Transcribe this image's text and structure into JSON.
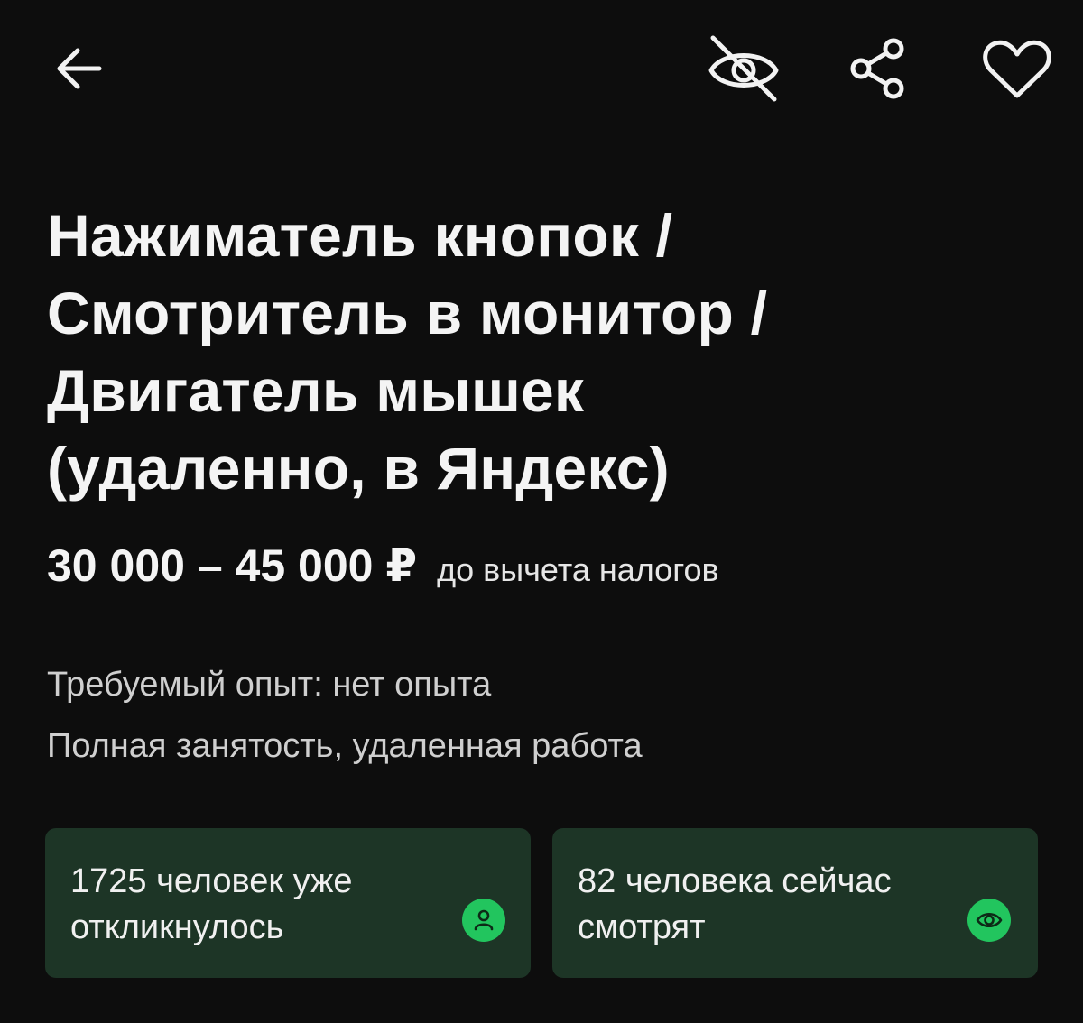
{
  "header": {
    "back_icon": "arrow-left-icon",
    "hide_icon": "eye-off-icon",
    "share_icon": "share-icon",
    "favorite_icon": "heart-icon"
  },
  "vacancy": {
    "title_lines": [
      "Нажиматель кнопок /",
      "Смотритель в монитор /",
      "Двигатель мышек",
      "(удаленно, в Яндекс)"
    ],
    "salary": "30 000 – 45 000 ₽",
    "salary_note": "до вычета налогов",
    "experience": "Требуемый опыт: нет опыта",
    "employment": "Полная занятость, удаленная работа"
  },
  "stats": {
    "responses_line1": "1725 человек уже",
    "responses_line2": "откликнулось",
    "viewers_line1": "82 человека сейчас",
    "viewers_line2": "смотрят"
  },
  "colors": {
    "background": "#0d0d0d",
    "card": "#1d3526",
    "accent": "#22c55e"
  }
}
